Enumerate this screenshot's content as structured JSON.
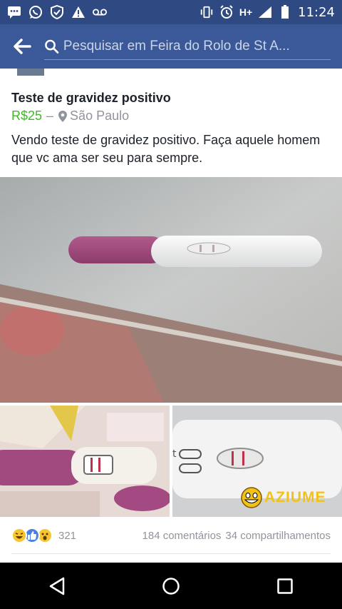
{
  "status_bar": {
    "time": "11:24",
    "network": "H+",
    "icons_left": [
      "message-icon",
      "whatsapp-icon",
      "shield-icon",
      "warning-icon",
      "voicemail-icon"
    ],
    "icons_right": [
      "vibrate-icon",
      "alarm-icon",
      "signal-icon",
      "battery-icon"
    ]
  },
  "header": {
    "search_placeholder": "Pesquisar em Feira do Rolo de St A..."
  },
  "post": {
    "title": "Teste de gravidez positivo",
    "price": "R$25",
    "separator": "–",
    "location": "São Paulo",
    "description": "Vendo teste de gravidez positivo. Faça aquele homem que vc ama ser seu para sempre.",
    "watermark": "AZIUME"
  },
  "footer": {
    "reaction_icons": [
      "haha-icon",
      "like-icon",
      "wow-icon"
    ],
    "reaction_count": "321",
    "comments": "184 comentários",
    "shares": "34 compartilhamentos"
  },
  "colors": {
    "header": "#3b5998",
    "statusbar": "#2f4a83",
    "price": "#42b72a",
    "muted": "#90949c"
  }
}
